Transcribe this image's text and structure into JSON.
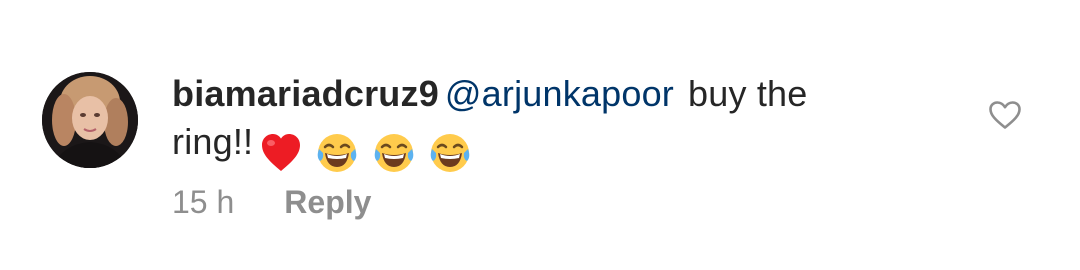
{
  "comment": {
    "username": "biamariadcruz9",
    "mention": "@arjunkapoor",
    "message_line1": "buy the",
    "message_line2": "ring!!",
    "emojis": [
      "red-heart",
      "face-with-tears-of-joy",
      "face-with-tears-of-joy",
      "face-with-tears-of-joy"
    ],
    "timestamp": "15 h",
    "reply_label": "Reply",
    "like_icon": "heart-outline-icon"
  },
  "colors": {
    "text": "#262626",
    "mention": "#003569",
    "meta": "#8e8e8e",
    "heart": "#ed1c24"
  }
}
